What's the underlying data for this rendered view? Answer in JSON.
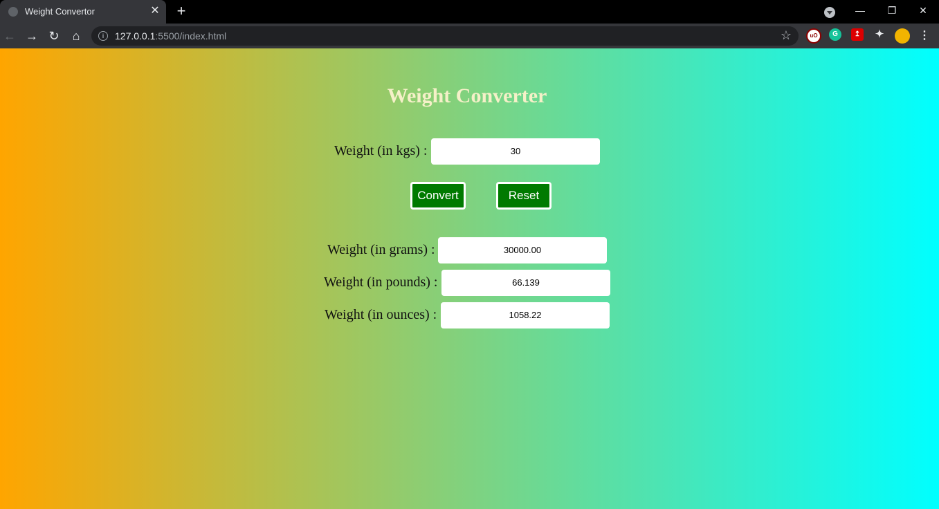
{
  "browser": {
    "tab_title": "Weight Convertor",
    "tab_close": "✕",
    "new_tab": "+",
    "url_host": "127.0.0.1",
    "url_rest": ":5500/index.html",
    "window_minimize": "—",
    "window_restore": "❐",
    "window_close": "✕"
  },
  "page": {
    "title": "Weight Converter",
    "kg_label": "Weight (in kgs) :",
    "kg_value": "30",
    "convert_label": "Convert",
    "reset_label": "Reset",
    "grams_label": "Weight (in grams) :",
    "grams_value": "30000.00",
    "pounds_label": "Weight (in pounds) :",
    "pounds_value": "66.139",
    "ounces_label": "Weight (in ounces) :",
    "ounces_value": "1058.22"
  },
  "colors": {
    "gradient_left": "#ffa500",
    "gradient_right": "#00ffff",
    "button_bg": "#007a00",
    "title_color": "#f5f0c8"
  }
}
